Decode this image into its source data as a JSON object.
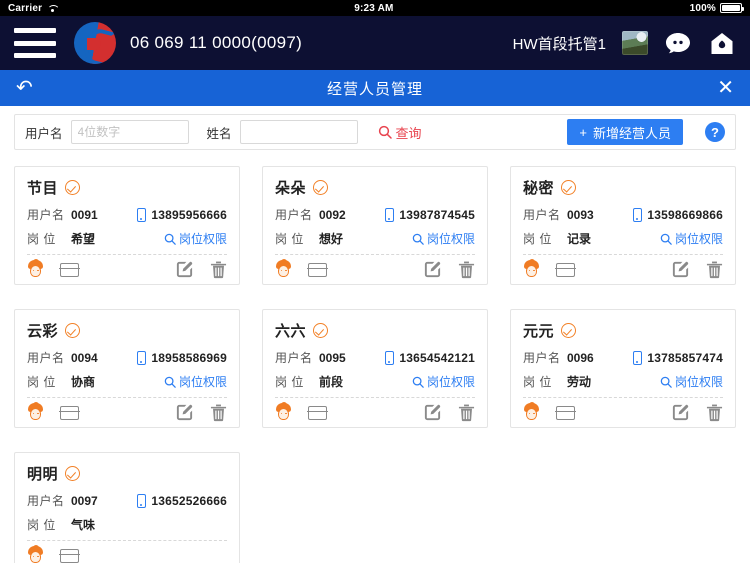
{
  "status_bar": {
    "carrier": "Carrier",
    "wifi_icon": "wifi-icon",
    "time": "9:23 AM",
    "battery_percent": "100%",
    "battery_icon": "battery-icon"
  },
  "app_bar": {
    "menu_icon": "hamburger-menu-icon",
    "logo_icon": "company-logo-icon",
    "account_code": "06 069 11 0000(0097)",
    "org_name": "HW首段托管1",
    "avatar_icon": "user-avatar",
    "chat_icon": "chat-face-icon",
    "home_icon": "home-icon"
  },
  "title_bar": {
    "back_icon": "back-arrow-icon",
    "title": "经营人员管理",
    "close_icon": "close-icon"
  },
  "filter_bar": {
    "username_label": "用户名",
    "username_value": "",
    "username_placeholder": "4位数字",
    "name_label": "姓名",
    "name_value": "",
    "name_placeholder": "",
    "search_icon": "search-icon",
    "search_label": "查询",
    "add_icon": "plus-icon",
    "add_label": "新增经营人员",
    "help_label": "?"
  },
  "card_labels": {
    "username": "用户名",
    "position": "岗 位",
    "permission_link": "岗位权限",
    "verified_icon": "check-circle-icon",
    "phone_icon": "mobile-phone-icon",
    "permission_search_icon": "search-icon",
    "person_icon": "person-icon",
    "idcard_icon": "id-card-icon",
    "edit_icon": "edit-icon",
    "delete_icon": "trash-icon"
  },
  "colors": {
    "appbar_bg": "#0d1033",
    "titlebar_bg": "#1763d6",
    "accent_blue": "#2d7ef2",
    "accent_orange": "#f07c24",
    "search_red": "#e8434e",
    "card_border": "#e4e4e4"
  },
  "cards": [
    {
      "name": "节目",
      "username": "0091",
      "phone": "13895956666",
      "position": "希望",
      "has_permission_link": true
    },
    {
      "name": "朵朵",
      "username": "0092",
      "phone": "13987874545",
      "position": "想好",
      "has_permission_link": true
    },
    {
      "name": "秘密",
      "username": "0093",
      "phone": "13598669866",
      "position": "记录",
      "has_permission_link": true
    },
    {
      "name": "云彩",
      "username": "0094",
      "phone": "18958586969",
      "position": "协商",
      "has_permission_link": true
    },
    {
      "name": "六六",
      "username": "0095",
      "phone": "13654542121",
      "position": "前段",
      "has_permission_link": true
    },
    {
      "name": "元元",
      "username": "0096",
      "phone": "13785857474",
      "position": "劳动",
      "has_permission_link": true
    },
    {
      "name": "明明",
      "username": "0097",
      "phone": "13652526666",
      "position": "气味",
      "has_permission_link": false
    }
  ]
}
